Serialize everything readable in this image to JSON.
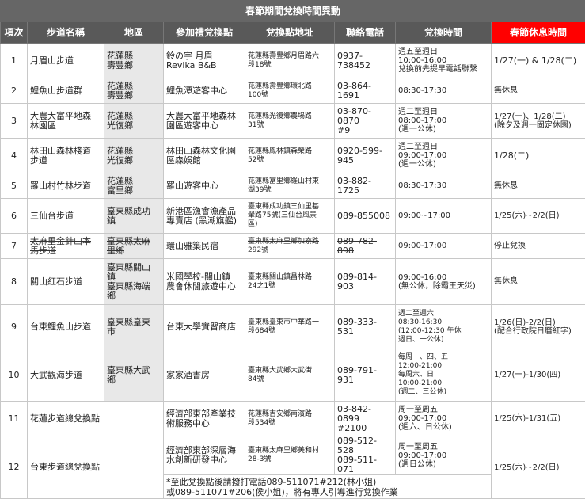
{
  "title": "春節期間兌換時間異動",
  "headers": [
    "項次",
    "步道名稱",
    "地區",
    "參加禮兌換點",
    "兌換點地址",
    "聯絡電話",
    "兌換時間",
    "春節休息時間"
  ],
  "rows": [
    {
      "no": "1",
      "trail": "月眉山步道",
      "area": "花蓮縣\n壽豐鄉",
      "point": "鈴の宇 月眉\nRevika B&B",
      "address": "花蓮縣壽豐鄉月眉路六\n段18號",
      "phone": "0937-738452",
      "time": "週五至週日\n10:00-16:00\n兌換前先提早電話聯繫",
      "holiday": "1/27(一) & 1/28(二)"
    },
    {
      "no": "2",
      "trail": "鯉魚山步道群",
      "area": "花蓮縣\n壽豐鄉",
      "point": "鯉魚潭遊客中心",
      "address": "花蓮縣壽豐鄉環北路\n100號",
      "phone": "03-864-1691",
      "time": "08:30-17:30",
      "holiday": "無休息"
    },
    {
      "no": "3",
      "trail": "大農大富平地森\n林園區",
      "area": "花蓮縣\n光復鄉",
      "point": "大農大富平地森林\n園區遊客中心",
      "address": "花蓮縣光復鄉農場路\n31號",
      "phone": "03-870-0870\n#9",
      "time": "週二至週日\n08:00-17:00\n(週一公休)",
      "holiday": "1/27(一)、1/28(二)\n(除夕及週一固定休園)"
    },
    {
      "no": "4",
      "trail": "林田山森林棧道\n步道",
      "area": "花蓮縣\n光復鄉",
      "point": "林田山森林文化園\n區森娛館",
      "address": "花蓮縣鳳林鎮森榮路\n52號",
      "phone": "0920-599-945",
      "time": "週二至週日\n09:00-17:00\n(週一公休)",
      "holiday": "1/28(二)"
    },
    {
      "no": "5",
      "trail": "羅山村竹林步道",
      "area": "花蓮縣\n富里鄉",
      "point": "羅山遊客中心",
      "address": "花蓮縣富里鄉羅山村東\n湖39號",
      "phone": "03-882-1725",
      "time": "08:30-17:30",
      "holiday": "無休息"
    },
    {
      "no": "6",
      "trail": "三仙台步道",
      "area": "臺東縣成功\n鎮",
      "point": "新港區漁會漁產品\n專賣店 (黑潮旗艦)",
      "address": "臺東縣成功鎮三仙里基\n翬路75號(三仙台風景\n區)",
      "phone": "089-855008",
      "time": "09:00~17:00",
      "holiday": "1/25(六)~2/2(日)"
    },
    {
      "no": "7",
      "trail": "太麻里金針山本\n馬步道",
      "area": "臺東縣太麻\n里鄉",
      "point": "環山雅築民宿",
      "address": "臺東縣太麻里鄉加寮路\n292號",
      "phone": "089-782-898",
      "time": "09:00-17:00",
      "holiday": "停止兌換"
    },
    {
      "no": "8",
      "trail": "關山紅石步道",
      "area": "臺東縣關山\n鎮\n臺東縣海端\n鄉",
      "point": "米國學校-關山鎮\n農會休閒旅遊中心",
      "address": "臺東縣關山鎮昌林路\n24之1號",
      "phone": "089-814-903",
      "time": "09:00-16:00\n(無公休，除霸王天災)",
      "holiday": "無休息"
    },
    {
      "no": "9",
      "trail": "台東鯉魚山步道",
      "area": "臺東縣臺東\n市",
      "point": "台東大學實習商店",
      "address": "臺東縣臺東市中華路一\n段684號",
      "phone": "089-333-531",
      "time": "週二至週六\n08:30-16:30\n(12:00-12:30 午休\n週日、一公休)",
      "holiday": "1/26(日)-2/2(日)\n(配合行政院日曆紅字)"
    },
    {
      "no": "10",
      "trail": "大武觀海步道",
      "area": "臺東縣大武\n鄉",
      "point": "家家酒書房",
      "address": "臺東縣大武鄉大武街\n84號",
      "phone": "089-791-931",
      "time": "每周一、四、五\n12:00-21:00\n每周六、日\n10:00-21:00\n(週二、三公休)",
      "holiday": "1/27(一)-1/30(四)"
    },
    {
      "no": "11",
      "trail": "花蓮步道總兌換點",
      "area": "",
      "point": "經濟部東部產業技\n術服務中心",
      "address": "花蓮縣吉安鄉南濱路一\n段534號",
      "phone": "03-842-0899\n#2100",
      "time": "周一至周五\n09:00-17:00\n(週六、日公休)",
      "holiday": "1/25(六)-1/31(五)"
    },
    {
      "no": "12",
      "trail": "台東步道總兌換點",
      "area": "",
      "point": "經濟部東部深層海\n水創新研發中心",
      "address": "臺東縣太麻里鄉美和村\n28-3號",
      "phone": "089-512-528\n089-511-071",
      "time": "周一至周五\n09:00-17:00\n(週日公休)",
      "holiday": "1/25(六)~2/2(日)"
    }
  ],
  "note": "*至此兌換點後請撥打電話089-511071#212(林小姐)\n或089-511071#206(侯小姐)，將有專人引導進行兌換作業",
  "colors": {
    "header": "#595959",
    "highlight": "#ff0000",
    "shade": "#e8e8e8"
  }
}
